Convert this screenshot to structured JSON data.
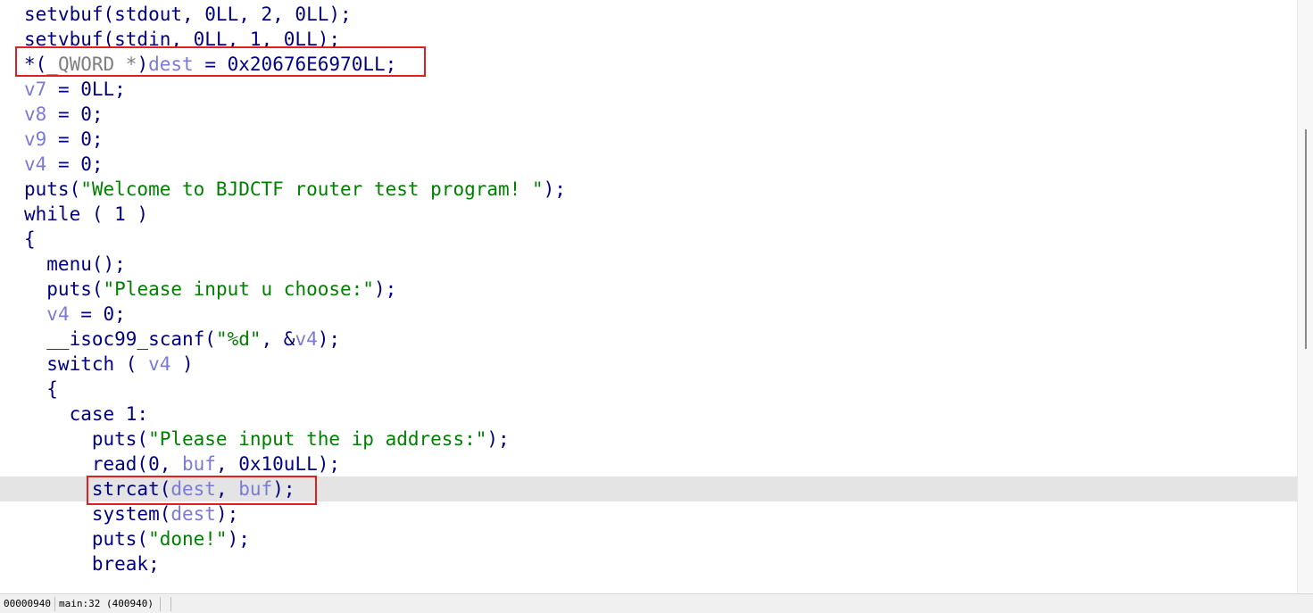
{
  "editor": {
    "lines": [
      {
        "tokens": [
          {
            "t": "setvbuf(stdout, 0LL, 2, 0LL);",
            "k": "default"
          }
        ]
      },
      {
        "tokens": [
          {
            "t": "setvbuf(stdin, 0LL, 1, 0LL);",
            "k": "default"
          }
        ]
      },
      {
        "tokens": [
          {
            "t": "*(",
            "k": "default"
          },
          {
            "t": "_QWORD *",
            "k": "type"
          },
          {
            "t": ")",
            "k": "default"
          },
          {
            "t": "dest",
            "k": "var"
          },
          {
            "t": " = 0x20676E6970LL;",
            "k": "default"
          }
        ]
      },
      {
        "tokens": [
          {
            "t": "v7",
            "k": "var"
          },
          {
            "t": " = 0LL;",
            "k": "default"
          }
        ]
      },
      {
        "tokens": [
          {
            "t": "v8",
            "k": "var"
          },
          {
            "t": " = 0;",
            "k": "default"
          }
        ]
      },
      {
        "tokens": [
          {
            "t": "v9",
            "k": "var"
          },
          {
            "t": " = 0;",
            "k": "default"
          }
        ]
      },
      {
        "tokens": [
          {
            "t": "v4",
            "k": "var"
          },
          {
            "t": " = 0;",
            "k": "default"
          }
        ]
      },
      {
        "tokens": [
          {
            "t": "puts(",
            "k": "default"
          },
          {
            "t": "\"Welcome to BJDCTF router test program! \"",
            "k": "string"
          },
          {
            "t": ");",
            "k": "default"
          }
        ]
      },
      {
        "tokens": [
          {
            "t": "while ( 1 )",
            "k": "default"
          }
        ]
      },
      {
        "tokens": [
          {
            "t": "{",
            "k": "default"
          }
        ]
      },
      {
        "tokens": [
          {
            "t": "  menu();",
            "k": "default"
          }
        ]
      },
      {
        "tokens": [
          {
            "t": "  puts(",
            "k": "default"
          },
          {
            "t": "\"Please input u choose:\"",
            "k": "string"
          },
          {
            "t": ");",
            "k": "default"
          }
        ]
      },
      {
        "tokens": [
          {
            "t": "  ",
            "k": "default"
          },
          {
            "t": "v4",
            "k": "var"
          },
          {
            "t": " = 0;",
            "k": "default"
          }
        ]
      },
      {
        "tokens": [
          {
            "t": "  __isoc99_scanf(",
            "k": "default"
          },
          {
            "t": "\"%d\"",
            "k": "string"
          },
          {
            "t": ", &",
            "k": "default"
          },
          {
            "t": "v4",
            "k": "var"
          },
          {
            "t": ");",
            "k": "default"
          }
        ]
      },
      {
        "tokens": [
          {
            "t": "  switch ( ",
            "k": "default"
          },
          {
            "t": "v4",
            "k": "var"
          },
          {
            "t": " )",
            "k": "default"
          }
        ]
      },
      {
        "tokens": [
          {
            "t": "  {",
            "k": "default"
          }
        ]
      },
      {
        "tokens": [
          {
            "t": "    case 1:",
            "k": "default"
          }
        ]
      },
      {
        "tokens": [
          {
            "t": "      puts(",
            "k": "default"
          },
          {
            "t": "\"Please input the ip address:\"",
            "k": "string"
          },
          {
            "t": ");",
            "k": "default"
          }
        ]
      },
      {
        "tokens": [
          {
            "t": "      read(0, ",
            "k": "default"
          },
          {
            "t": "buf",
            "k": "var"
          },
          {
            "t": ", 0x10uLL);",
            "k": "default"
          }
        ]
      },
      {
        "current": true,
        "tokens": [
          {
            "t": "      strcat(",
            "k": "default"
          },
          {
            "t": "dest",
            "k": "var"
          },
          {
            "t": ", ",
            "k": "default"
          },
          {
            "t": "buf",
            "k": "var"
          },
          {
            "t": ");",
            "k": "default"
          }
        ]
      },
      {
        "tokens": [
          {
            "t": "      system(",
            "k": "default"
          },
          {
            "t": "dest",
            "k": "var"
          },
          {
            "t": ");",
            "k": "default"
          }
        ]
      },
      {
        "tokens": [
          {
            "t": "      puts(",
            "k": "default"
          },
          {
            "t": "\"done!\"",
            "k": "string"
          },
          {
            "t": ");",
            "k": "default"
          }
        ]
      },
      {
        "tokens": [
          {
            "t": "      break;",
            "k": "default"
          }
        ]
      }
    ]
  },
  "statusbar": {
    "address": "00000940",
    "location": "main:32 (400940)"
  },
  "colors": {
    "default": "#000080",
    "var": "#7b7bd6",
    "string": "#008000",
    "type": "#7f7f7f",
    "annotation_box": "#e02020",
    "current_line": "#e4e4e4"
  }
}
